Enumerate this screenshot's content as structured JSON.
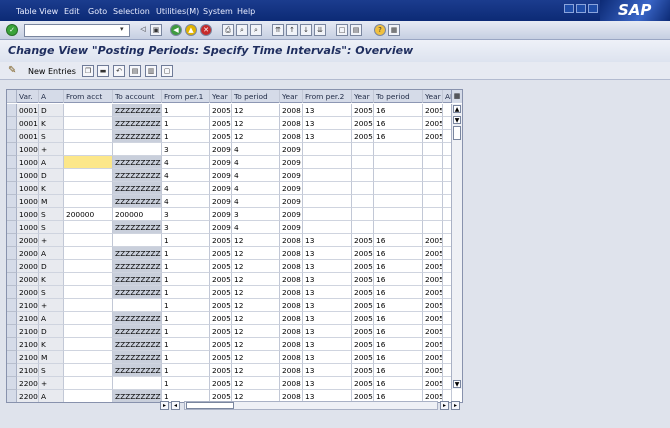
{
  "menu": [
    "Table View",
    "Edit",
    "Goto",
    "Selection",
    "Utilities(M)",
    "System",
    "Help"
  ],
  "brand": "SAP",
  "title": "Change View \"Posting Periods: Specify Time Intervals\": Overview",
  "toolbar": {
    "new_entries_label": "New Entries"
  },
  "table": {
    "headers": [
      "Var.",
      "A",
      "From acct",
      "To account",
      "From per.1",
      "Year",
      "To period",
      "Year",
      "From per.2",
      "Year",
      "To period",
      "Year",
      "AL"
    ],
    "rows": [
      [
        "0001",
        "D",
        "",
        "ZZZZZZZZZZ",
        "1",
        "2005",
        "12",
        "2008",
        "13",
        "2005",
        "16",
        "2005"
      ],
      [
        "0001",
        "K",
        "",
        "ZZZZZZZZZZ",
        "1",
        "2005",
        "12",
        "2008",
        "13",
        "2005",
        "16",
        "2005"
      ],
      [
        "0001",
        "S",
        "",
        "ZZZZZZZZZZ",
        "1",
        "2005",
        "12",
        "2008",
        "13",
        "2005",
        "16",
        "2005"
      ],
      [
        "1000",
        "+",
        "",
        "",
        "3",
        "2009",
        "4",
        "2009",
        "",
        "",
        "",
        ""
      ],
      [
        "1000",
        "A",
        "",
        "ZZZZZZZZZZ",
        "4",
        "2009",
        "4",
        "2009",
        "",
        "",
        "",
        ""
      ],
      [
        "1000",
        "D",
        "",
        "ZZZZZZZZZZ",
        "4",
        "2009",
        "4",
        "2009",
        "",
        "",
        "",
        ""
      ],
      [
        "1000",
        "K",
        "",
        "ZZZZZZZZZZ",
        "4",
        "2009",
        "4",
        "2009",
        "",
        "",
        "",
        ""
      ],
      [
        "1000",
        "M",
        "",
        "ZZZZZZZZZZ",
        "4",
        "2009",
        "4",
        "2009",
        "",
        "",
        "",
        ""
      ],
      [
        "1000",
        "S",
        "200000",
        "200000",
        "3",
        "2009",
        "3",
        "2009",
        "",
        "",
        "",
        ""
      ],
      [
        "1000",
        "S",
        "",
        "ZZZZZZZZZZ",
        "3",
        "2009",
        "4",
        "2009",
        "",
        "",
        "",
        ""
      ],
      [
        "2000",
        "+",
        "",
        "",
        "1",
        "2005",
        "12",
        "2008",
        "13",
        "2005",
        "16",
        "2005"
      ],
      [
        "2000",
        "A",
        "",
        "ZZZZZZZZZZ",
        "1",
        "2005",
        "12",
        "2008",
        "13",
        "2005",
        "16",
        "2005"
      ],
      [
        "2000",
        "D",
        "",
        "ZZZZZZZZZZ",
        "1",
        "2005",
        "12",
        "2008",
        "13",
        "2005",
        "16",
        "2005"
      ],
      [
        "2000",
        "K",
        "",
        "ZZZZZZZZZZ",
        "1",
        "2005",
        "12",
        "2008",
        "13",
        "2005",
        "16",
        "2005"
      ],
      [
        "2000",
        "S",
        "",
        "ZZZZZZZZZZ",
        "1",
        "2005",
        "12",
        "2008",
        "13",
        "2005",
        "16",
        "2005"
      ],
      [
        "2100",
        "+",
        "",
        "",
        "1",
        "2005",
        "12",
        "2008",
        "13",
        "2005",
        "16",
        "2005"
      ],
      [
        "2100",
        "A",
        "",
        "ZZZZZZZZZZ",
        "1",
        "2005",
        "12",
        "2008",
        "13",
        "2005",
        "16",
        "2005"
      ],
      [
        "2100",
        "D",
        "",
        "ZZZZZZZZZZ",
        "1",
        "2005",
        "12",
        "2008",
        "13",
        "2005",
        "16",
        "2005"
      ],
      [
        "2100",
        "K",
        "",
        "ZZZZZZZZZZ",
        "1",
        "2005",
        "12",
        "2008",
        "13",
        "2005",
        "16",
        "2005"
      ],
      [
        "2100",
        "M",
        "",
        "ZZZZZZZZZZ",
        "1",
        "2005",
        "12",
        "2008",
        "13",
        "2005",
        "16",
        "2005"
      ],
      [
        "2100",
        "S",
        "",
        "ZZZZZZZZZZ",
        "1",
        "2005",
        "12",
        "2008",
        "13",
        "2005",
        "16",
        "2005"
      ],
      [
        "2200",
        "+",
        "",
        "",
        "1",
        "2005",
        "12",
        "2008",
        "13",
        "2005",
        "16",
        "2005"
      ],
      [
        "2200",
        "A",
        "",
        "ZZZZZZZZZZ",
        "1",
        "2005",
        "12",
        "2008",
        "13",
        "2005",
        "16",
        "2005"
      ]
    ]
  }
}
